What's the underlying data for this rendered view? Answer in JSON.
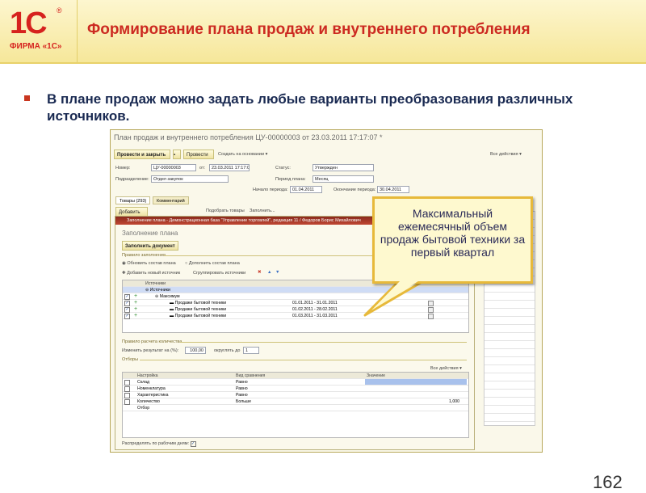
{
  "header": {
    "logo_mark": "1С",
    "logo_reg": "®",
    "logo_firm": "ФИРМА «1С»",
    "title": "Формирование плана продаж и внутреннего потребления"
  },
  "lead_text": "В плане продаж можно задать любые варианты преобразования различных источников.",
  "page_number": "162",
  "callout": {
    "text": "Максимальный ежемесячный объем продаж бытовой техники за первый квартал"
  },
  "document": {
    "title": "План продаж и внутреннего потребления ЦУ-00000003 от 23.03.2011 17:17:07 *",
    "toolbar": {
      "post_close": "Провести и закрыть",
      "post": "Провести",
      "create_based": "Создать на основании ▾",
      "all_actions": "Все действия ▾"
    },
    "fields": {
      "number_label": "Номер:",
      "number_value": "ЦУ-00000003",
      "from_label": "от:",
      "date_value": "23.03.2011 17:17:07",
      "status_label": "Статус:",
      "status_value": "Утвержден",
      "subdivision_label": "Подразделение:",
      "subdivision_value": "Отдел закупок",
      "period_label": "Период плана:",
      "period_value": "Месяц",
      "start_label": "Начало периода:",
      "start_value": "01.04.2011",
      "end_label": "Окончание периода:",
      "end_value": "30.04.2011"
    },
    "tabs": [
      "Товары (293)",
      "Комментарий"
    ],
    "tab_toolbar": {
      "add": "Добавить",
      "pick": "Подобрать товары",
      "fill": "Заполнить..."
    }
  },
  "dialog": {
    "bar_title": "Заполнение плана - Демонстрационная база \"Управление торговлей\", редакция 11 / Федоров Борис Михайлович",
    "heading": "Заполнение плана",
    "fill_button": "Заполнить документ",
    "fill_rule_label": "Правило заполнения",
    "radio_update": "Обновить состав плана",
    "radio_add": "Дополнить состав плана",
    "sources_toolbar": {
      "add_source": "Добавить новый источник",
      "group_sources": "Сгруппировать источники"
    },
    "sources_header": "Источники",
    "sources_root": "Источники",
    "sources_group": "Максимум",
    "sources_rows": [
      {
        "name": "Продажи бытовой техники",
        "period": "01.01.2011 - 31.01.2011"
      },
      {
        "name": "Продажи бытовой техники",
        "period": "01.02.2011 - 28.02.2011"
      },
      {
        "name": "Продажи бытовой техники",
        "period": "01.03.2011 - 31.03.2011"
      }
    ],
    "calc_rule_label": "Правило расчета количества",
    "change_label": "Изменить результат на (%):",
    "change_value": "100,00",
    "round_label": "округлять до",
    "round_value": "1",
    "filters_label": "Отборы",
    "filters_all_actions": "Все действия ▾",
    "filters_header": {
      "setting": "Настройка",
      "compare": "Вид сравнения",
      "value": "Значение"
    },
    "filters_rows": [
      {
        "setting": "Склад",
        "compare": "Равно",
        "value": ""
      },
      {
        "setting": "Номенклатура",
        "compare": "Равно",
        "value": ""
      },
      {
        "setting": "Характеристика",
        "compare": "Равно",
        "value": ""
      },
      {
        "setting": "Количество",
        "compare": "Больше",
        "value": "1,000"
      },
      {
        "setting": "Отбор",
        "compare": "",
        "value": ""
      }
    ],
    "distribute_label": "Распределять по рабочим дням:"
  }
}
